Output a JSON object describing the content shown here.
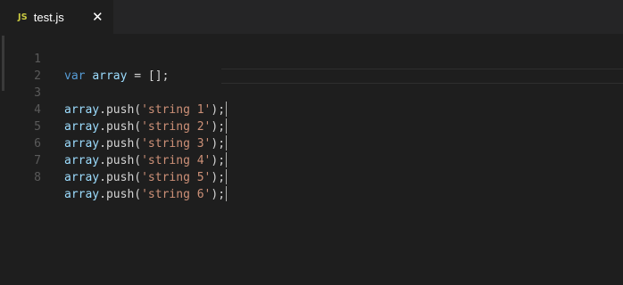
{
  "tab": {
    "icon_text": "JS",
    "label": "test.js",
    "close_glyph": "✕",
    "icon": "javascript-file-icon"
  },
  "editor": {
    "lines": [
      {
        "number": "1",
        "tokens": {
          "kw": "var",
          "ident": "array",
          "rest": " = [];"
        }
      },
      {
        "number": "2"
      },
      {
        "number": "3",
        "tokens": {
          "obj": "array",
          "fn": ".push(",
          "str": "'string 1'",
          "rest": ");"
        }
      },
      {
        "number": "4",
        "tokens": {
          "obj": "array",
          "fn": ".push(",
          "str": "'string 2'",
          "rest": ");"
        }
      },
      {
        "number": "5",
        "tokens": {
          "obj": "array",
          "fn": ".push(",
          "str": "'string 3'",
          "rest": ");"
        }
      },
      {
        "number": "6",
        "tokens": {
          "obj": "array",
          "fn": ".push(",
          "str": "'string 4'",
          "rest": ");"
        }
      },
      {
        "number": "7",
        "tokens": {
          "obj": "array",
          "fn": ".push(",
          "str": "'string 5'",
          "rest": ");"
        }
      },
      {
        "number": "8",
        "tokens": {
          "obj": "array",
          "fn": ".push(",
          "str": "'string 6'",
          "rest": ");"
        }
      }
    ]
  },
  "colors": {
    "background": "#1e1e1e",
    "keyword": "#569cd6",
    "identifier": "#9cdcfe",
    "string": "#ce9178",
    "js_icon": "#cbcb41"
  }
}
